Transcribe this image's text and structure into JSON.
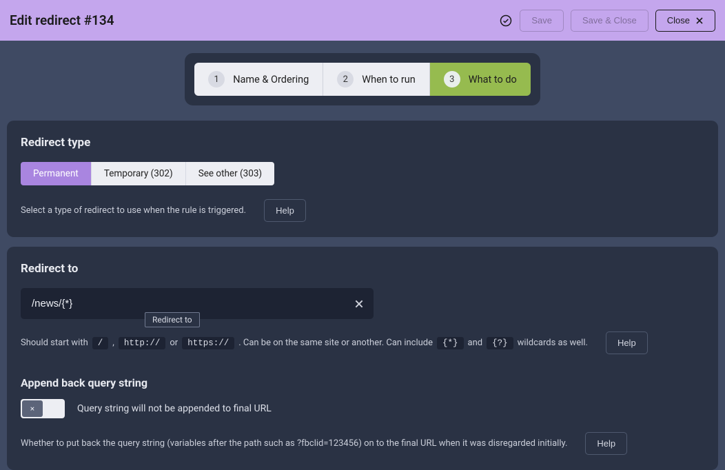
{
  "header": {
    "title": "Edit redirect #134",
    "save": "Save",
    "save_close": "Save & Close",
    "close": "Close"
  },
  "steps": [
    {
      "num": "1",
      "label": "Name & Ordering"
    },
    {
      "num": "2",
      "label": "When to run"
    },
    {
      "num": "3",
      "label": "What to do"
    }
  ],
  "redirect_type": {
    "title": "Redirect type",
    "options": [
      {
        "label": "Permanent"
      },
      {
        "label": "Temporary (302)"
      },
      {
        "label": "See other (303)"
      }
    ],
    "hint": "Select a type of redirect to use when the rule is triggered.",
    "help": "Help"
  },
  "redirect_to": {
    "title": "Redirect to",
    "value": "/news/{*}",
    "hint": {
      "p1": "Should start with",
      "c1": "/",
      "comma": ",",
      "c2": "http://",
      "or": "or",
      "c3": "https://",
      "p2": ". Can be on the same site or another. Can include",
      "c4": "{*}",
      "and": "and",
      "c5": "{?}",
      "p3": "wildcards as well."
    },
    "tooltip": "Redirect to",
    "help": "Help"
  },
  "append_qs": {
    "title": "Append back query string",
    "toggle_glyph": "×",
    "status": "Query string will not be appended to final URL",
    "hint": "Whether to put back the query string (variables after the path such as ?fbclid=123456) on to the final URL when it was disregarded initially.",
    "help": "Help"
  }
}
